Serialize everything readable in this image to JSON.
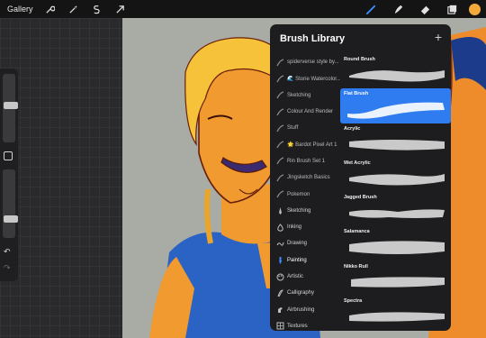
{
  "toolbar": {
    "gallery_label": "Gallery",
    "left_tools": [
      "wrench-icon",
      "magic-wand-icon",
      "selection-icon",
      "transform-arrow-icon"
    ],
    "right_tools": [
      "brush-icon",
      "smudge-icon",
      "eraser-icon",
      "layers-icon"
    ],
    "current_color": "#f3a93a"
  },
  "brush_library": {
    "title": "Brush Library",
    "add_label": "+",
    "sets": [
      {
        "label": "spiderverse style by...",
        "icon": "brush-stroke-icon",
        "custom": true
      },
      {
        "label": "🌊 Storie Watercolor...",
        "icon": "brush-stroke-icon",
        "custom": true
      },
      {
        "label": "Sketching",
        "icon": "brush-stroke-icon",
        "custom": true
      },
      {
        "label": "Colour And Render",
        "icon": "brush-stroke-icon",
        "custom": true
      },
      {
        "label": "Stuff",
        "icon": "brush-stroke-icon",
        "custom": true
      },
      {
        "label": "🌟 Bardot Pixel Art 1",
        "icon": "brush-stroke-icon",
        "custom": true
      },
      {
        "label": "Rin Brush Set 1",
        "icon": "brush-stroke-icon",
        "custom": true
      },
      {
        "label": "Jingsketch Basics",
        "icon": "brush-stroke-icon",
        "custom": true
      },
      {
        "label": "Pokemon",
        "icon": "brush-stroke-icon",
        "custom": true
      },
      {
        "label": "Sketching",
        "icon": "pencil-icon",
        "custom": false
      },
      {
        "label": "Inking",
        "icon": "ink-drop-icon",
        "custom": false
      },
      {
        "label": "Drawing",
        "icon": "drawing-stroke-icon",
        "custom": false
      },
      {
        "label": "Painting",
        "icon": "paint-brush-icon",
        "custom": false,
        "active": true
      },
      {
        "label": "Artistic",
        "icon": "palette-icon",
        "custom": false
      },
      {
        "label": "Calligraphy",
        "icon": "calligraphy-icon",
        "custom": false
      },
      {
        "label": "Airbrushing",
        "icon": "airbrush-icon",
        "custom": false
      },
      {
        "label": "Textures",
        "icon": "texture-grid-icon",
        "custom": false
      }
    ],
    "brushes": [
      {
        "name": "Round Brush",
        "selected": false
      },
      {
        "name": "Flat Brush",
        "selected": true
      },
      {
        "name": "Acrylic",
        "selected": false
      },
      {
        "name": "Wet Acrylic",
        "selected": false
      },
      {
        "name": "Jagged Brush",
        "selected": false
      },
      {
        "name": "Salamanca",
        "selected": false
      },
      {
        "name": "Nikko Rull",
        "selected": false
      },
      {
        "name": "Spectra",
        "selected": false
      }
    ],
    "selected_color": "#2f7bf0"
  },
  "sidebar": {
    "brush_size_level": 0.55,
    "opacity_level": 0.25,
    "undo_label": "↶",
    "redo_label": "↷"
  }
}
